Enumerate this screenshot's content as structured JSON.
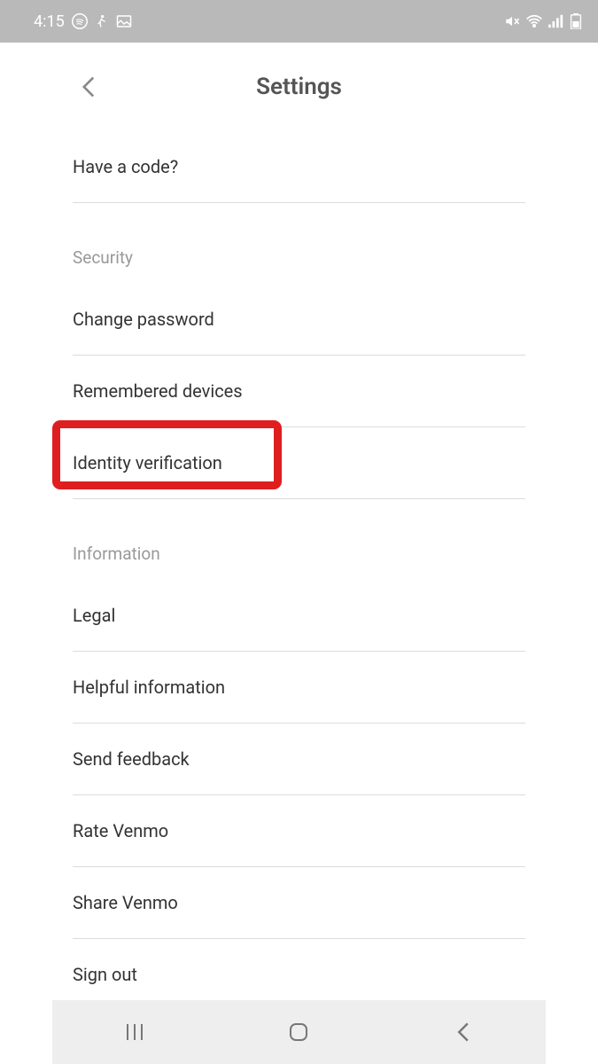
{
  "statusBar": {
    "time": "4:15"
  },
  "header": {
    "title": "Settings"
  },
  "sections": {
    "item_have_code": "Have a code?",
    "security_header": "Security",
    "item_change_password": "Change password",
    "item_remembered_devices": "Remembered devices",
    "item_identity_verification": "Identity verification",
    "information_header": "Information",
    "item_legal": "Legal",
    "item_helpful_information": "Helpful information",
    "item_send_feedback": "Send feedback",
    "item_rate_venmo": "Rate Venmo",
    "item_share_venmo": "Share Venmo",
    "item_sign_out": "Sign out"
  }
}
